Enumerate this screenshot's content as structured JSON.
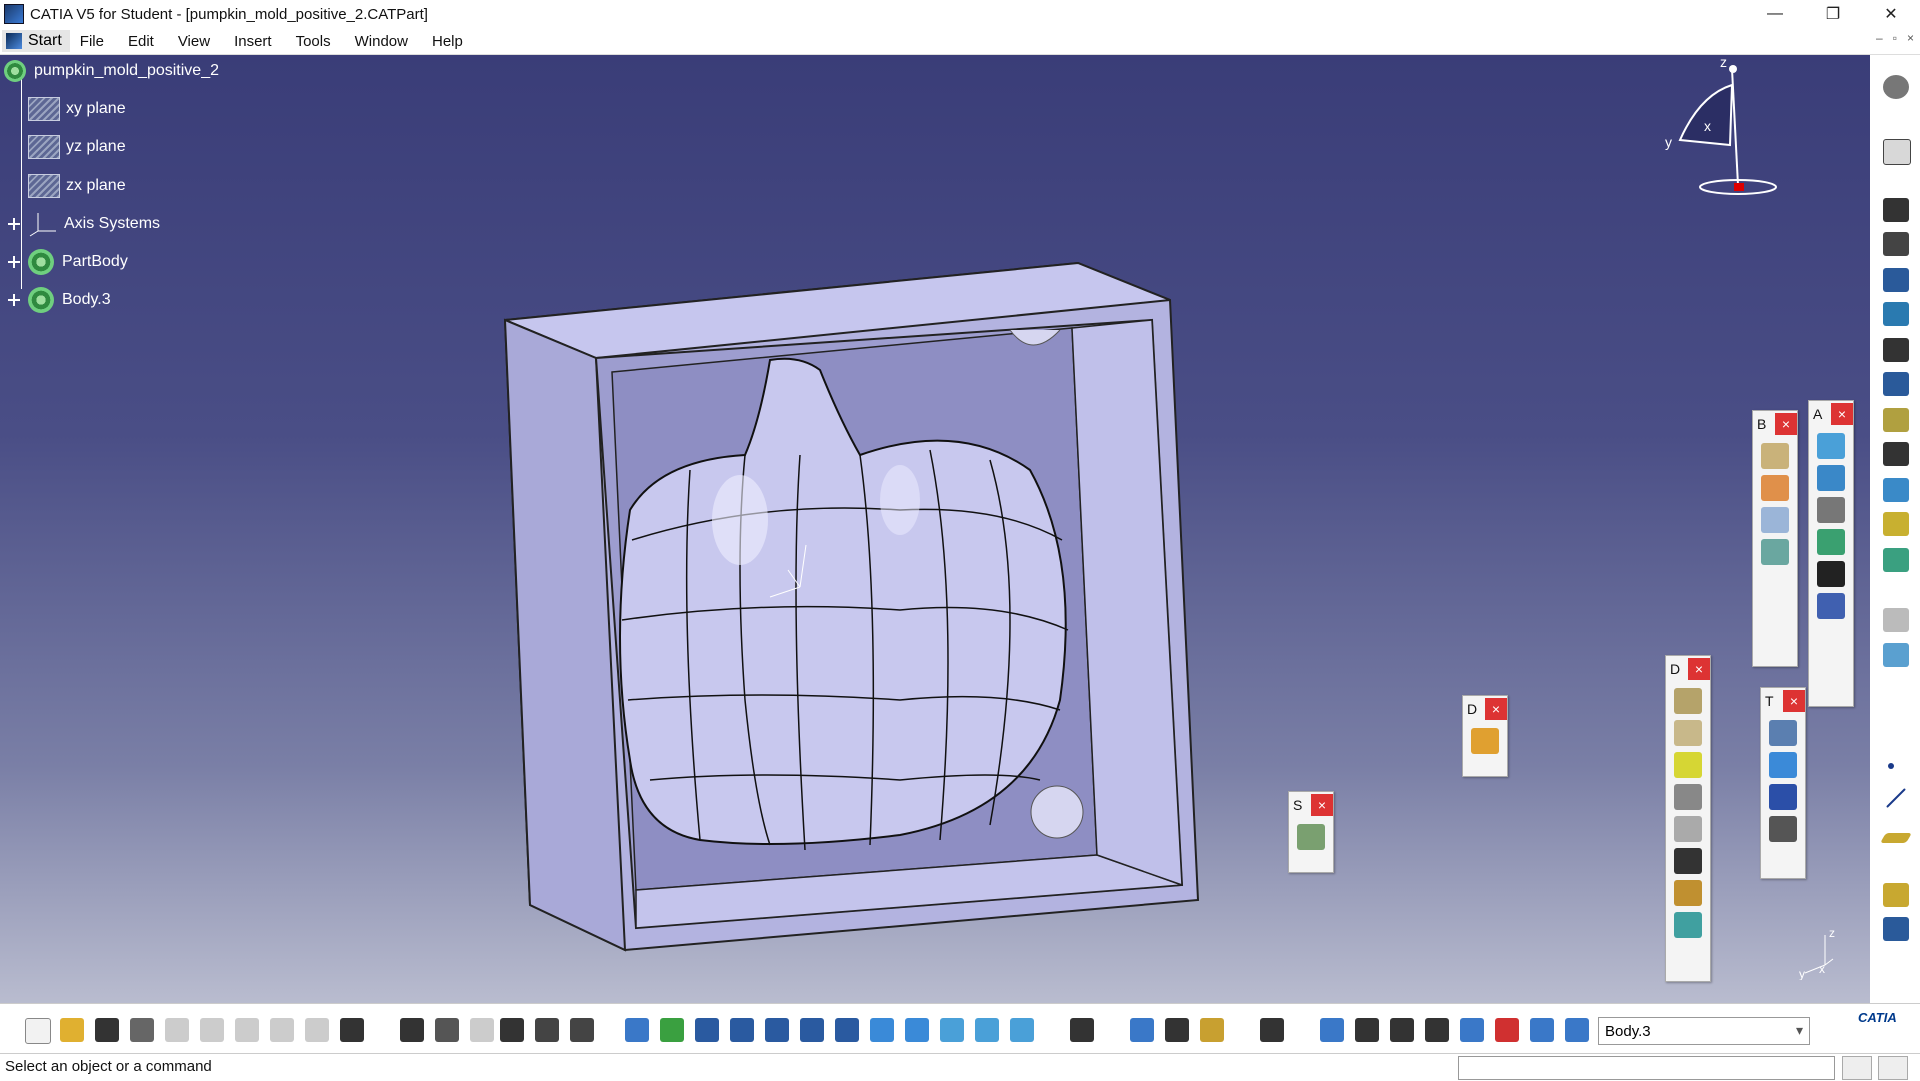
{
  "window": {
    "title": "CATIA V5 for Student - [pumpkin_mold_positive_2.CATPart]",
    "controls": [
      "—",
      "❐",
      "✕"
    ]
  },
  "menu": {
    "start": "Start",
    "items": [
      "File",
      "Edit",
      "View",
      "Insert",
      "Tools",
      "Window",
      "Help"
    ],
    "mdi_controls": [
      "–",
      "▫",
      "×"
    ]
  },
  "tree": {
    "root": "pumpkin_mold_positive_2",
    "items": [
      {
        "label": "xy plane",
        "icon": "plane-icon"
      },
      {
        "label": "yz plane",
        "icon": "plane-icon"
      },
      {
        "label": "zx plane",
        "icon": "plane-icon"
      },
      {
        "label": "Axis Systems",
        "icon": "axis-icon"
      },
      {
        "label": "PartBody",
        "icon": "body-icon"
      },
      {
        "label": "Body.3",
        "icon": "body-icon"
      }
    ]
  },
  "compass": {
    "z": "z",
    "x": "x",
    "y": "y"
  },
  "mini_axis": {
    "z": "z",
    "x": "x",
    "y": "y"
  },
  "palettes": [
    {
      "letter": "B",
      "close": "×"
    },
    {
      "letter": "A",
      "close": "×"
    },
    {
      "letter": "D",
      "close": "×"
    },
    {
      "letter": "D",
      "close": "×"
    },
    {
      "letter": "T",
      "close": "×"
    },
    {
      "letter": "S",
      "close": "×"
    }
  ],
  "bottom": {
    "current_body": "Body.3",
    "brand": "CATIA"
  },
  "status": {
    "message": "Select an object or a command"
  },
  "colors": {
    "viewport_top": "#3a3d78",
    "viewport_bottom": "#b9bccf",
    "mold": "#b9b9e6",
    "palette_close": "#dd3333"
  }
}
